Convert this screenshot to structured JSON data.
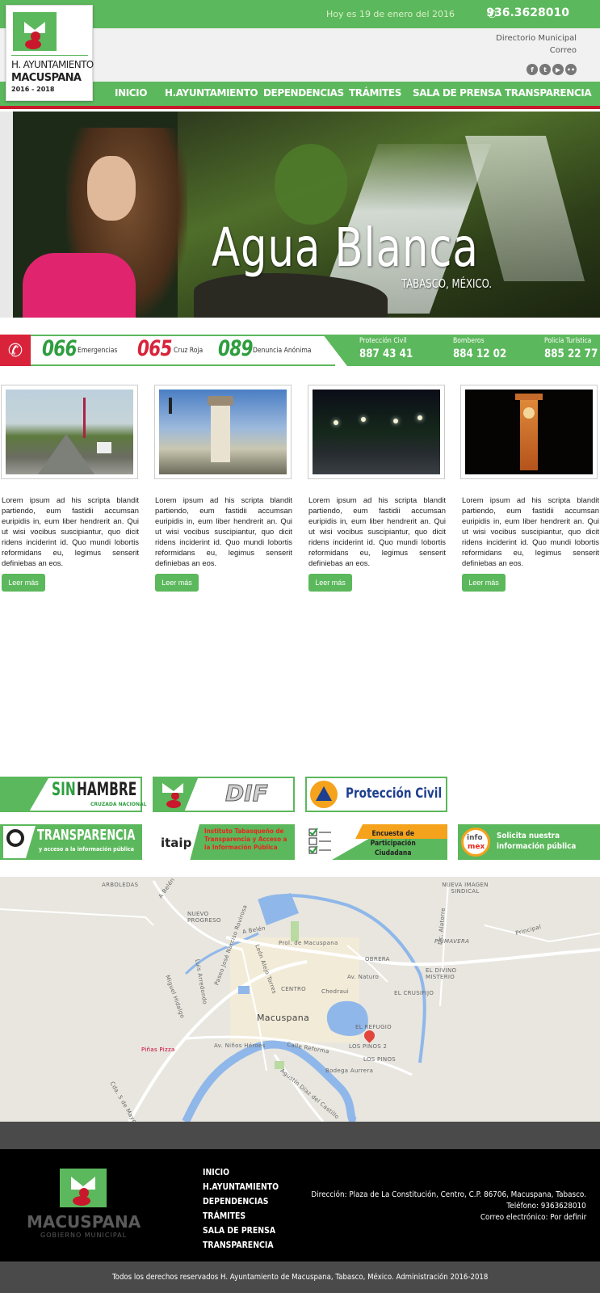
{
  "header": {
    "date_text": "Hoy es 19 de enero del 2016",
    "phone": "936.3628010",
    "links": [
      "Directorio Municipal",
      "Correo"
    ],
    "social_icons": [
      "facebook-icon",
      "twitter-icon",
      "youtube-icon",
      "flickr-icon"
    ]
  },
  "logo": {
    "line1": "H. AYUNTAMIENTO",
    "line2": "MACUSPANA",
    "line3": "2016 - 2018"
  },
  "nav": [
    "INICIO",
    "H.AYUNTAMIENTO",
    "DEPENDENCIAS",
    "TRÁMITES",
    "SALA DE PRENSA",
    "TRANSPARENCIA"
  ],
  "hero": {
    "title": "Agua Blanca",
    "subtitle": "TABASCO, MÉXICO."
  },
  "emergency": {
    "numbers": [
      {
        "number": "066",
        "label": "Emergencias",
        "color": "#2e9e3e"
      },
      {
        "number": "065",
        "label": "Cruz Roja",
        "color": "#d9233a"
      },
      {
        "number": "089",
        "label": "Denuncia Anónima",
        "color": "#2e9e3e"
      }
    ],
    "services": [
      {
        "name": "Protección Civil",
        "phone": "887 43 41"
      },
      {
        "name": "Bomberos",
        "phone": "884 12 02"
      },
      {
        "name": "Policía Turística",
        "phone": "885 22 77"
      }
    ]
  },
  "cards": [
    {
      "text": "Lorem ipsum ad his scripta blandit partiendo, eum fastidii accumsan euripidis in, eum liber hendrerit an. Qui ut wisi vocibus suscipiantur, quo dicit ridens inciderint id. Quo mundi lobortis reformidans eu, legimus senserit definiebas an eos.",
      "button": "Leer más"
    },
    {
      "text": "Lorem ipsum ad his scripta blandit partiendo, eum fastidii accumsan euripidis in, eum liber hendrerit an. Qui ut wisi vocibus suscipiantur, quo dicit ridens inciderint id. Quo mundi lobortis reformidans eu, legimus senserit definiebas an eos.",
      "button": "Leer más"
    },
    {
      "text": "Lorem ipsum ad his scripta blandit partiendo, eum fastidii accumsan euripidis in, eum liber hendrerit an. Qui ut wisi vocibus suscipiantur, quo dicit ridens inciderint id. Quo mundi lobortis reformidans eu, legimus senserit definiebas an eos.",
      "button": "Leer más"
    },
    {
      "text": "Lorem ipsum ad his scripta blandit partiendo, eum fastidii accumsan euripidis in, eum liber hendrerit an. Qui ut wisi vocibus suscipiantur, quo dicit ridens inciderint id. Quo mundi lobortis reformidans eu, legimus senserit definiebas an eos.",
      "button": "Leer más"
    }
  ],
  "banners": {
    "sinhambre": {
      "a": "SIN",
      "b": "HAMBRE",
      "sub": "CRUZADA NACIONAL"
    },
    "dif": "DIF",
    "proteccion": "Protección Civil",
    "transparencia": {
      "title": "TRANSPARENCIA",
      "sub": "y acceso a la información pública"
    },
    "itaip": {
      "logo": "itaip",
      "text": "Instituto Tabasqueño de Transparencia y Acceso a la Información Pública"
    },
    "encuesta": "Encuesta de Participación Ciudadana",
    "infomex": {
      "logo_a": "info",
      "logo_b": "mex",
      "text": "Solicita nuestra información pública"
    }
  },
  "map": {
    "labels": [
      "ARBOLEDAS",
      "NUEVA IMAGEN SINDICAL",
      "A Belén",
      "NUEVO PROGRESO",
      "A Belén",
      "Prol. de Macuspana",
      "PRIMAVERA",
      "OBRERA",
      "EL DIVINO MISTERIO",
      "CENTRO",
      "Chedraui",
      "Av. Naturo",
      "EL CRUSIFIJO",
      "Macuspana",
      "EL REFUGIO",
      "LOS PINOS 2",
      "LOS PINOS",
      "Av. Niños Héroes",
      "Calle Reforma",
      "Piñas Pizza",
      "Bodega Aurrera",
      "Agustín Díaz del Castillo",
      "Cda. 5 de Mayo",
      "Paseo José Narciso Rovirosa",
      "León Alejo Torres",
      "Lic. Alatorre",
      "Principal",
      "Miguel Hidalgo",
      "Luis Arredondo"
    ]
  },
  "footer": {
    "brand": "MACUSPANA",
    "brand_sub": "GOBIERNO MUNICIPAL",
    "nav": [
      "INICIO",
      "H.AYUNTAMIENTO",
      "DEPENDENCIAS",
      "TRÁMITES",
      "SALA DE PRENSA",
      "TRANSPARENCIA"
    ],
    "address": "Dirección: Plaza de La Constitución, Centro, C.P. 86706, Macuspana, Tabasco.",
    "phone": "Teléfono: 9363628010",
    "email": "Correo electrónico: Por definir",
    "copyright": "Todos los derechos reservados H. Ayuntamiento de Macuspana, Tabasco, México. Administración 2016-2018"
  }
}
